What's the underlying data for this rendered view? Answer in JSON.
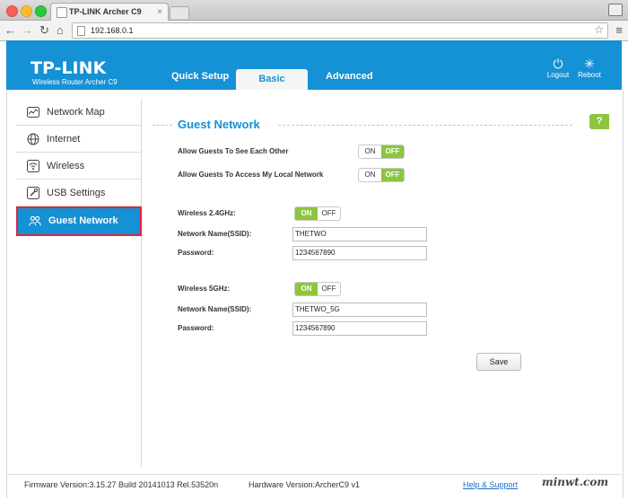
{
  "browser": {
    "tab_title": "TP-LINK Archer C9",
    "tab_close": "×",
    "url": "192.168.0.1"
  },
  "header": {
    "logo": "TP-LINK",
    "model": "Wireless Router Archer C9",
    "tabs": {
      "quick_setup": "Quick Setup",
      "basic": "Basic",
      "advanced": "Advanced"
    },
    "logout": "Logout",
    "reboot": "Reboot"
  },
  "sidebar": {
    "items": [
      {
        "label": "Network Map",
        "icon": "network-map-icon"
      },
      {
        "label": "Internet",
        "icon": "globe-icon"
      },
      {
        "label": "Wireless",
        "icon": "wifi-icon"
      },
      {
        "label": "USB Settings",
        "icon": "wrench-icon"
      },
      {
        "label": "Guest Network",
        "icon": "users-icon"
      }
    ]
  },
  "main": {
    "title": "Guest Network",
    "allow_see": {
      "label": "Allow Guests To See Each Other",
      "on": "ON",
      "off": "OFF",
      "state": "OFF"
    },
    "allow_local": {
      "label": "Allow Guests To Access My Local Network",
      "on": "ON",
      "off": "OFF",
      "state": "OFF"
    },
    "band24": {
      "label": "Wireless 2.4GHz:",
      "on": "ON",
      "off": "OFF",
      "state": "ON",
      "ssid_label": "Network Name(SSID):",
      "ssid": "THETWO",
      "pass_label": "Password:",
      "password": "1234567890"
    },
    "band5": {
      "label": "Wireless 5GHz:",
      "on": "ON",
      "off": "OFF",
      "state": "ON",
      "ssid_label": "Network Name(SSID):",
      "ssid": "THETWO_5G",
      "pass_label": "Password:",
      "password": "1234567890"
    },
    "save": "Save",
    "help": "?"
  },
  "footer": {
    "firmware": "Firmware Version:3.15.27 Build 20141013 Rel.53520n",
    "hardware": "Hardware Version:ArcherC9 v1",
    "help_support": "Help & Support"
  },
  "watermark": "minwt.com",
  "colors": {
    "brand": "#1591d5",
    "toggle_on": "#8cc63f",
    "active_border": "#e0253d"
  }
}
